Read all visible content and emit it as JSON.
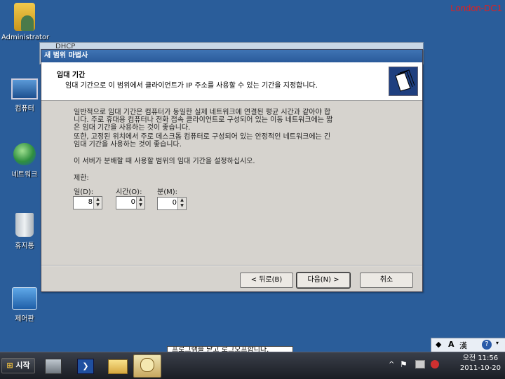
{
  "server_label": "London-DC1",
  "desktop_icons": [
    {
      "label": "Administrator",
      "icon": "user-folder-icon"
    },
    {
      "label": "컴퓨터",
      "icon": "computer-icon"
    },
    {
      "label": "네트워크",
      "icon": "network-icon"
    },
    {
      "label": "휴지통",
      "icon": "recycle-bin-icon"
    },
    {
      "label": "제어판",
      "icon": "control-panel-icon"
    }
  ],
  "background_window": {
    "title": "DHCP"
  },
  "dialog": {
    "title": "새 범위 마법사",
    "header_title": "임대 기간",
    "header_subtitle": "임대 기간으로 이 범위에서 클라이언트가 IP 주소를 사용할 수 있는 기간을 지정합니다.",
    "para1_line1": "일반적으로 임대 기간은 컴퓨터가 동일한 실제 네트워크에 연결된 평균 시간과 같아야 합",
    "para1_line2": "니다. 주로 휴대용 컴퓨터나 전화 접속 클라이언트로 구성되어 있는 이동 네트워크에는 짧",
    "para1_line3": "은 임대 기간을 사용하는 것이 좋습니다.",
    "para2_line1": "또한, 고정된 위치에서 주로 데스크톱 컴퓨터로 구성되어 있는 안정적인 네트워크에는 긴",
    "para2_line2": "임대 기간을 사용하는 것이 좋습니다.",
    "para3": "이 서버가 분배할 때 사용할 범위의 임대 기간을 설정하십시오.",
    "limit_label": "제한:",
    "days_label": "일(D):",
    "days_value": "8",
    "hours_label": "시간(O):",
    "hours_value": "0",
    "minutes_label": "분(M):",
    "minutes_value": "0",
    "back_button": "< 뒤로(B)",
    "next_button": "다음(N) >",
    "cancel_button": "취소"
  },
  "tooltip_text": "프로그램을 닫고 로그오프합니다.",
  "taskbar": {
    "start_label": "시작",
    "time": "오전 11:56",
    "date": "2011-10-20"
  },
  "language_bar": {
    "mode_letter": "A",
    "hanja": "漢",
    "help": "?"
  }
}
